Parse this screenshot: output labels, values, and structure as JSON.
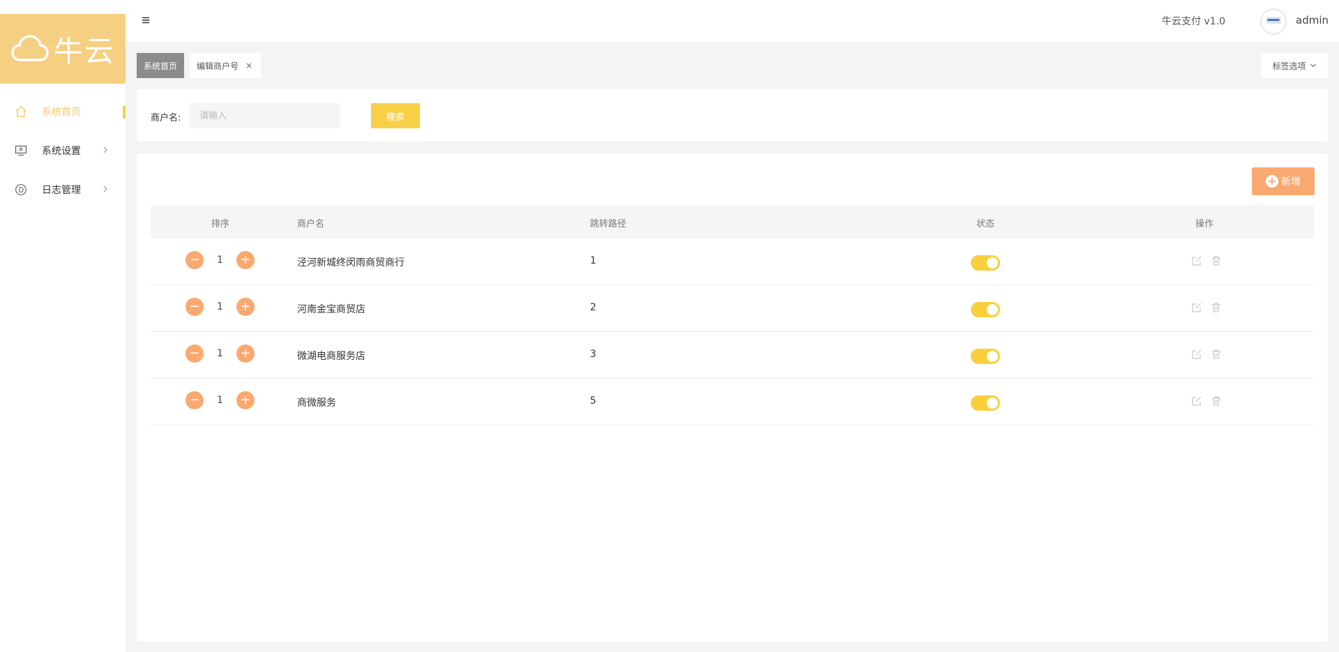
{
  "sidebar": {
    "logo_text": "牛云",
    "items": [
      {
        "label": "系统首页",
        "icon": "home-icon",
        "active": true
      },
      {
        "label": "系统设置",
        "icon": "monitor-icon",
        "has_children": true
      },
      {
        "label": "日志管理",
        "icon": "log-icon",
        "has_children": true
      }
    ]
  },
  "header": {
    "version": "牛云支付 v1.0",
    "username": "admin"
  },
  "tabs": {
    "items": [
      {
        "label": "系统首页"
      },
      {
        "label": "编辑商户号",
        "close": "×"
      }
    ],
    "options_label": "标签选项"
  },
  "search": {
    "label": "商户名:",
    "placeholder": "请输入",
    "button": "搜索"
  },
  "toolbar": {
    "add_label": "新增"
  },
  "table": {
    "headers": [
      "排序",
      "商户名",
      "跳转路径",
      "状态",
      "操作"
    ],
    "rows": [
      {
        "sort": "1",
        "merchant": "泾河新城终闵雨商贸商行",
        "path": "1",
        "enabled": true
      },
      {
        "sort": "1",
        "merchant": "河南金宝商贸店",
        "path": "2",
        "enabled": true
      },
      {
        "sort": "1",
        "merchant": "微湖电商服务店",
        "path": "3",
        "enabled": true
      },
      {
        "sort": "1",
        "merchant": "商微服务",
        "path": "5",
        "enabled": true
      }
    ]
  },
  "colors": {
    "logo_bg": "#f5cf82",
    "accent_yellow": "#f8d047",
    "accent_orange": "#f9a970",
    "active_nav": "#f6c86a"
  }
}
